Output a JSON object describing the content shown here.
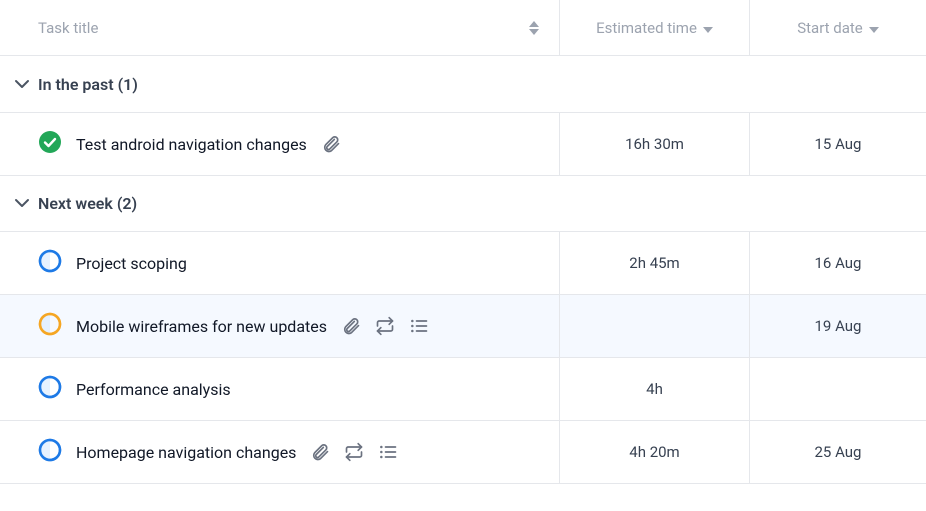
{
  "columns": {
    "title": "Task title",
    "estimated": "Estimated time",
    "startDate": "Start date"
  },
  "groups": [
    {
      "label": "In the past (1)",
      "tasks": [
        {
          "title": "Test android navigation changes",
          "status": "done",
          "estimated": "16h 30m",
          "startDate": "15 Aug",
          "icons": [
            "attachment"
          ],
          "highlight": false
        }
      ]
    },
    {
      "label": "Next week (2)",
      "tasks": [
        {
          "title": "Project scoping",
          "status": "open-blue",
          "estimated": "2h 45m",
          "startDate": "16 Aug",
          "icons": [],
          "highlight": false
        },
        {
          "title": "Mobile wireframes for new updates",
          "status": "open-orange",
          "estimated": "",
          "startDate": "19 Aug",
          "icons": [
            "attachment",
            "repeat",
            "list"
          ],
          "highlight": true
        },
        {
          "title": "Performance analysis",
          "status": "open-blue",
          "estimated": "4h",
          "startDate": "",
          "icons": [],
          "highlight": false
        },
        {
          "title": "Homepage navigation changes",
          "status": "open-blue",
          "estimated": "4h 20m",
          "startDate": "25 Aug",
          "icons": [
            "attachment",
            "repeat",
            "list"
          ],
          "highlight": false
        }
      ]
    }
  ]
}
